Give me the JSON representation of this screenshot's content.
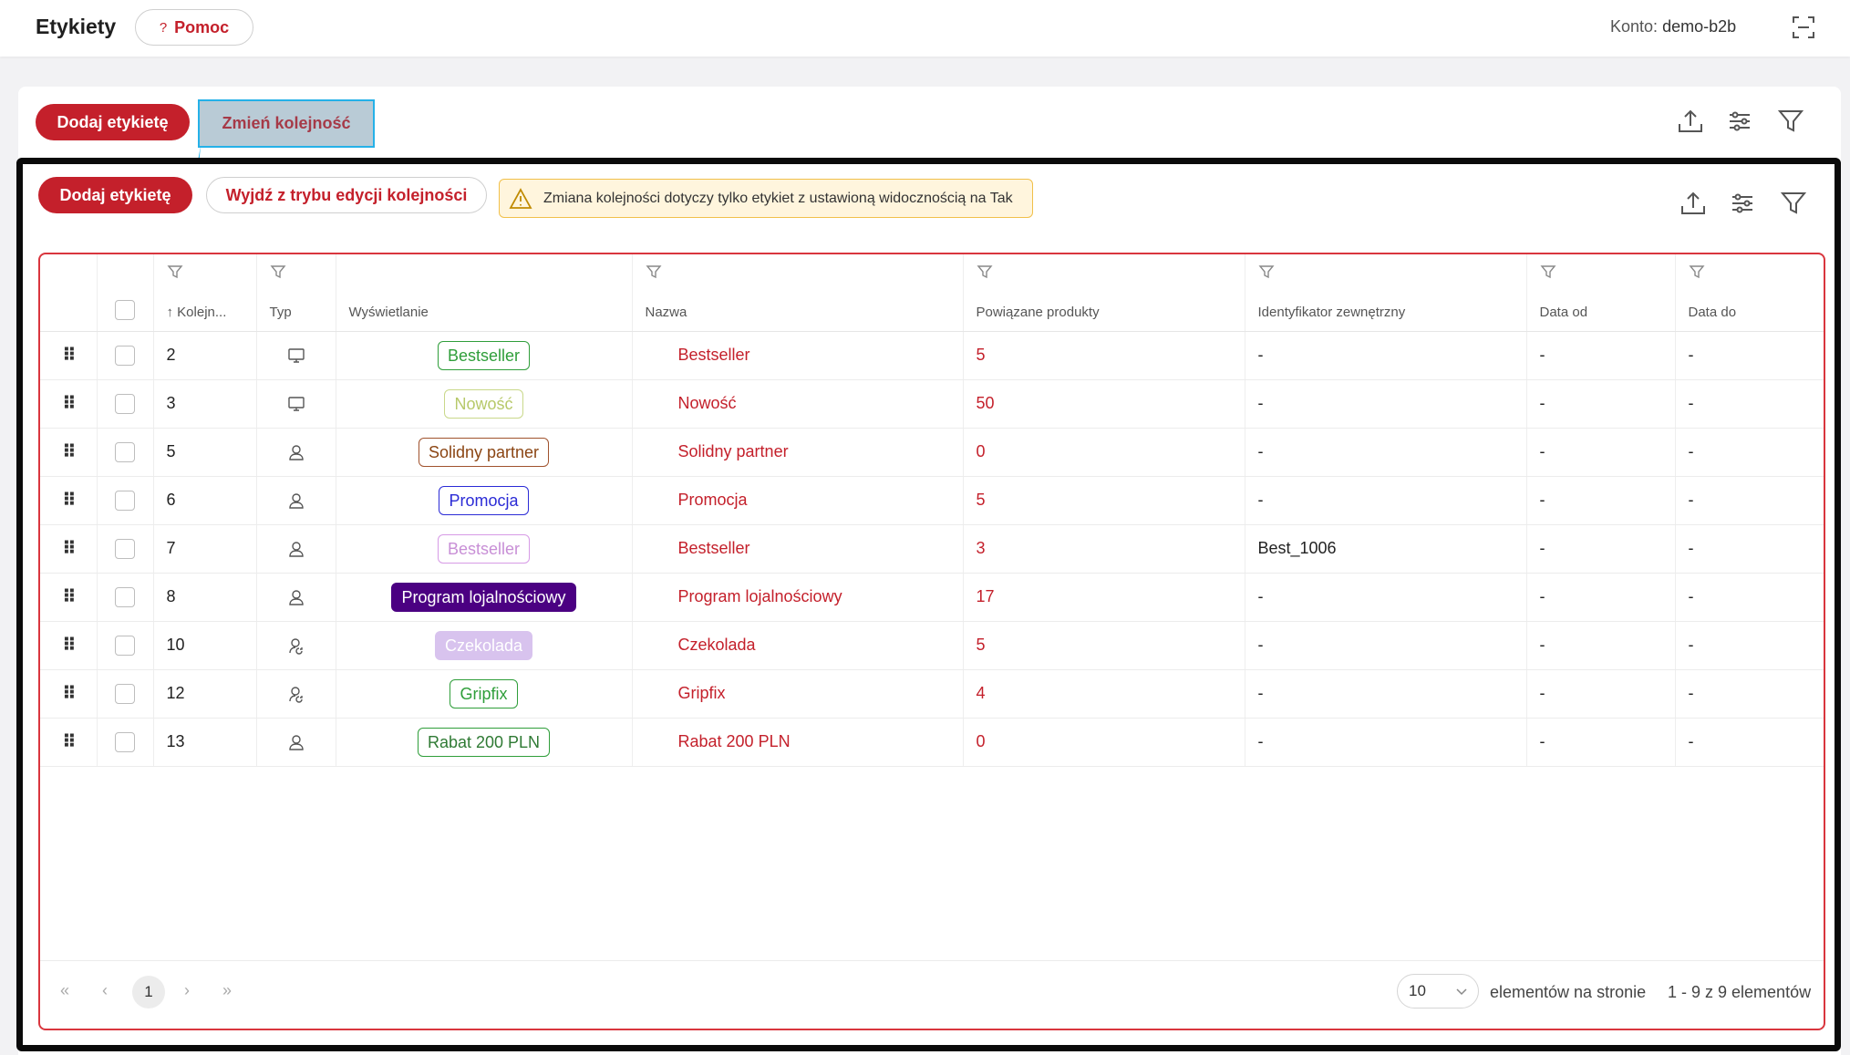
{
  "header": {
    "title": "Etykiety",
    "help_label": "Pomoc",
    "help_icon": "?",
    "account_label": "Konto:",
    "account_value": "demo-b2b"
  },
  "toolbar": {
    "add_label": "Dodaj etykietę",
    "reorder_label": "Zmień kolejność"
  },
  "edit_mode": {
    "add_label": "Dodaj etykietę",
    "exit_label": "Wyjdź z trybu edycji kolejności",
    "warning": "Zmiana kolejności dotyczy tylko etykiet z ustawioną widocznością na Tak"
  },
  "table": {
    "columns": {
      "order": "Kolejn...",
      "type": "Typ",
      "display": "Wyświetlanie",
      "name": "Nazwa",
      "products": "Powiązane produkty",
      "external_id": "Identyfikator zewnętrzny",
      "date_from": "Data od",
      "date_to": "Data do"
    },
    "rows": [
      {
        "order": "2",
        "type_icon": "monitor-icon",
        "display": "Bestseller",
        "tag_color": "#2f9e3a",
        "tag_bg": "#ffffff",
        "tag_text": "#2f9e3a",
        "name": "Bestseller",
        "products": "5",
        "external_id": "-",
        "date_from": "-",
        "date_to": "-"
      },
      {
        "order": "3",
        "type_icon": "monitor-icon",
        "display": "Nowość",
        "tag_color": "#c9d88a",
        "tag_bg": "#ffffff",
        "tag_text": "#b7c96a",
        "name": "Nowość",
        "products": "50",
        "external_id": "-",
        "date_from": "-",
        "date_to": "-"
      },
      {
        "order": "5",
        "type_icon": "user-icon",
        "display": "Solidny partner",
        "tag_color": "#a0522d",
        "tag_bg": "#ffffff",
        "tag_text": "#8b4513",
        "name": "Solidny partner",
        "products": "0",
        "external_id": "-",
        "date_from": "-",
        "date_to": "-"
      },
      {
        "order": "6",
        "type_icon": "user-icon",
        "display": "Promocja",
        "tag_color": "#2b2bd6",
        "tag_bg": "#ffffff",
        "tag_text": "#2b2bd6",
        "name": "Promocja",
        "products": "5",
        "external_id": "-",
        "date_from": "-",
        "date_to": "-"
      },
      {
        "order": "7",
        "type_icon": "user-icon",
        "display": "Bestseller",
        "tag_color": "#d79be6",
        "tag_bg": "#ffffff",
        "tag_text": "#c88fd6",
        "name": "Bestseller",
        "products": "3",
        "external_id": "Best_1006",
        "date_from": "-",
        "date_to": "-"
      },
      {
        "order": "8",
        "type_icon": "user-icon",
        "display": "Program lojalnościowy",
        "tag_color": "#4b0082",
        "tag_bg": "#4b0082",
        "tag_text": "#ffffff",
        "name": "Program lojalnościowy",
        "products": "17",
        "external_id": "-",
        "date_from": "-",
        "date_to": "-"
      },
      {
        "order": "10",
        "type_icon": "user-sync-icon",
        "display": "Czekolada",
        "tag_color": "#d8c3ee",
        "tag_bg": "#d8c3ee",
        "tag_text": "#ffffff",
        "name": "Czekolada",
        "products": "5",
        "external_id": "-",
        "date_from": "-",
        "date_to": "-"
      },
      {
        "order": "12",
        "type_icon": "user-sync-icon",
        "display": "Gripfix",
        "tag_color": "#2f9e3a",
        "tag_bg": "#ffffff",
        "tag_text": "#2f9e3a",
        "name": "Gripfix",
        "products": "4",
        "external_id": "-",
        "date_from": "-",
        "date_to": "-"
      },
      {
        "order": "13",
        "type_icon": "user-icon",
        "display": "Rabat 200 PLN",
        "tag_color": "#2f9e3a",
        "tag_bg": "#ffffff",
        "tag_text": "#2f7a34",
        "name": "Rabat 200 PLN",
        "products": "0",
        "external_id": "-",
        "date_from": "-",
        "date_to": "-"
      }
    ]
  },
  "pagination": {
    "current_page": "1",
    "page_size": "10",
    "per_page_label": "elementów na stronie",
    "range_label": "1 - 9 z 9 elementów"
  },
  "colors": {
    "brand": "#c4202b",
    "highlight_border": "#25b1e8",
    "warning_bg": "#fff5dd"
  }
}
